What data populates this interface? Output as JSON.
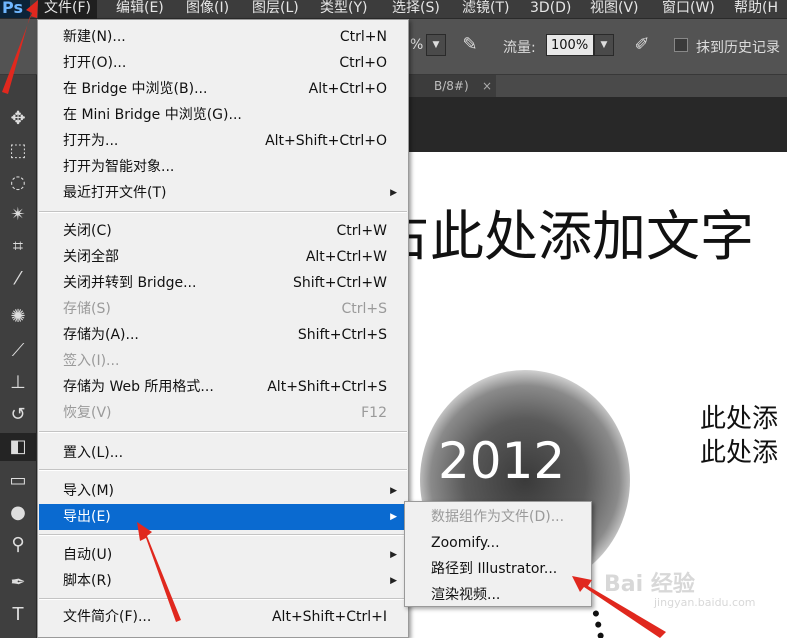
{
  "app": {
    "logo": "Ps"
  },
  "menubar": {
    "items": [
      "文件(F)",
      "编辑(E)",
      "图像(I)",
      "图层(L)",
      "类型(Y)",
      "选择(S)",
      "滤镜(T)",
      "3D(D)",
      "视图(V)",
      "窗口(W)",
      "帮助(H"
    ]
  },
  "options": {
    "percent_left": "%",
    "flow_label": "流量:",
    "flow_value": "100%",
    "history_label": "抹到历史记录"
  },
  "tab": {
    "label": "B/8#)",
    "close": "×"
  },
  "canvas": {
    "heading": "占此处添加文字",
    "year": "2012",
    "body_line1": "此处添",
    "body_line2": "此处添"
  },
  "file_menu": {
    "items": [
      {
        "label": "新建(N)...",
        "shortcut": "Ctrl+N"
      },
      {
        "label": "打开(O)...",
        "shortcut": "Ctrl+O"
      },
      {
        "label": "在 Bridge 中浏览(B)...",
        "shortcut": "Alt+Ctrl+O"
      },
      {
        "label": "在 Mini Bridge 中浏览(G)...",
        "shortcut": ""
      },
      {
        "label": "打开为...",
        "shortcut": "Alt+Shift+Ctrl+O"
      },
      {
        "label": "打开为智能对象...",
        "shortcut": ""
      },
      {
        "label": "最近打开文件(T)",
        "shortcut": ""
      },
      {
        "label": "关闭(C)",
        "shortcut": "Ctrl+W"
      },
      {
        "label": "关闭全部",
        "shortcut": "Alt+Ctrl+W"
      },
      {
        "label": "关闭并转到 Bridge...",
        "shortcut": "Shift+Ctrl+W"
      },
      {
        "label": "存储(S)",
        "shortcut": "Ctrl+S"
      },
      {
        "label": "存储为(A)...",
        "shortcut": "Shift+Ctrl+S"
      },
      {
        "label": "签入(I)...",
        "shortcut": ""
      },
      {
        "label": "存储为 Web 所用格式...",
        "shortcut": "Alt+Shift+Ctrl+S"
      },
      {
        "label": "恢复(V)",
        "shortcut": "F12"
      },
      {
        "label": "置入(L)...",
        "shortcut": ""
      },
      {
        "label": "导入(M)",
        "shortcut": ""
      },
      {
        "label": "导出(E)",
        "shortcut": ""
      },
      {
        "label": "自动(U)",
        "shortcut": ""
      },
      {
        "label": "脚本(R)",
        "shortcut": ""
      },
      {
        "label": "文件简介(F)...",
        "shortcut": "Alt+Shift+Ctrl+I"
      }
    ]
  },
  "export_submenu": {
    "items": [
      "数据组作为文件(D)...",
      "Zoomify...",
      "路径到 Illustrator...",
      "渲染视频..."
    ]
  },
  "watermark": {
    "brand": "Bai 经验",
    "url": "jingyan.baidu.com"
  },
  "colors": {
    "highlight": "#0a6ad0",
    "arrow": "#e0281e"
  }
}
